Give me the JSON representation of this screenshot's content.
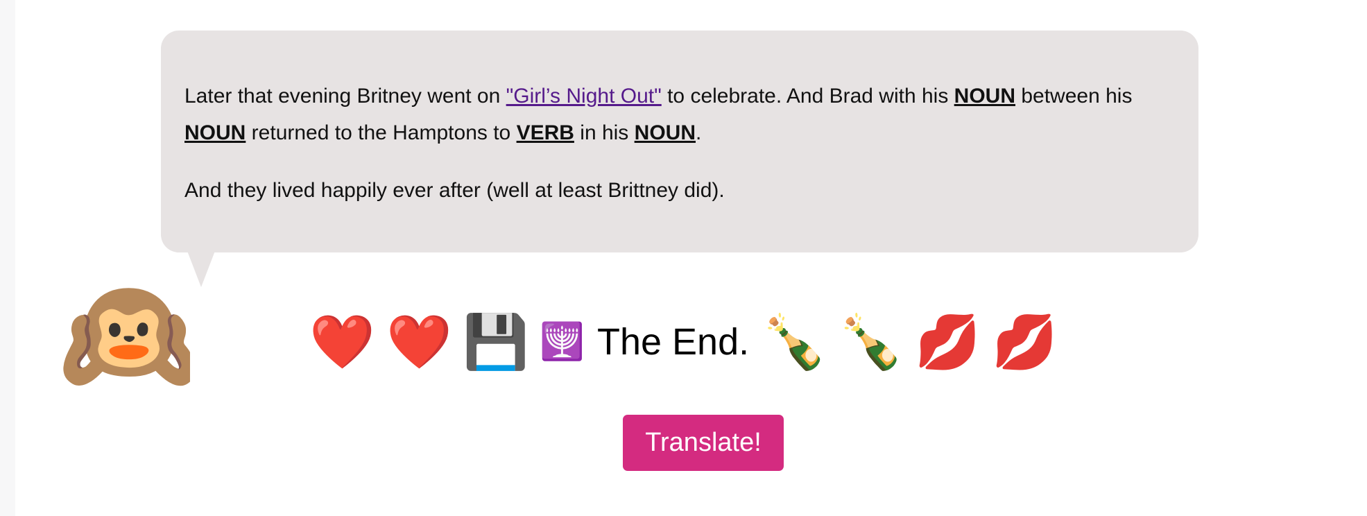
{
  "story": {
    "paragraph1": {
      "text1": "Later that evening Britney went on ",
      "link": "\"Girl’s Night Out\"",
      "text2": " to celebrate. And Brad with his ",
      "blank1": "NOUN",
      "text3": " between his ",
      "blank2": "NOUN",
      "text4": " returned to the Hamptons to ",
      "blank3": "VERB",
      "text5": " in his ",
      "blank4": "NOUN",
      "text6": "."
    },
    "paragraph2": "And they lived happily ever after (well at least Brittney did)."
  },
  "avatar": {
    "emoji": "🙉",
    "icon": "hear-no-evil-monkey-icon"
  },
  "ending": {
    "emojis_before": [
      "❤️",
      "❤️",
      "💾",
      "🕎"
    ],
    "text": "The End.",
    "emojis_after": [
      "🍾",
      "🍾",
      "💋",
      "💋"
    ],
    "icons": [
      "heart-icon",
      "heart-icon",
      "floppy-disk-icon",
      "menorah-icon",
      "champagne-icon",
      "champagne-icon",
      "kiss-mark-icon",
      "kiss-mark-icon"
    ]
  },
  "translate_button": {
    "label": "Translate!"
  },
  "colors": {
    "bubble": "#e7e3e3",
    "button": "#d42b80",
    "link": "#551a8b"
  }
}
